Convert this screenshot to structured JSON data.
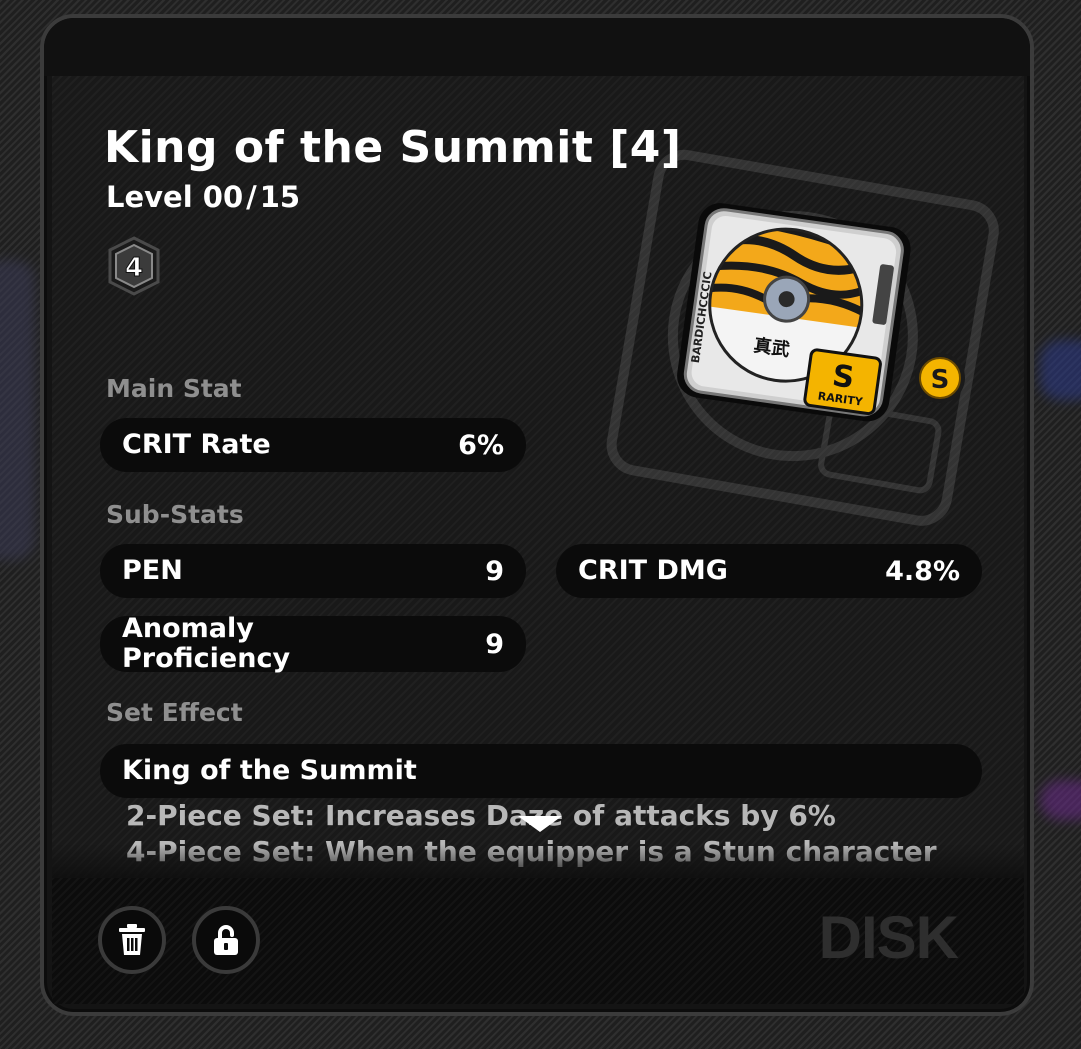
{
  "disk": {
    "name": "King of the Summit",
    "slot_label": "[4]",
    "level_label": "Level",
    "level_current": "00",
    "level_separator": "/",
    "level_max": "15",
    "slot_badge": "4",
    "rank_badge": "S",
    "art_rank_letter": "S",
    "art_rank_text": "RARITY",
    "art_brand_text": "BARDICHCCCIC",
    "art_kanji": "真武"
  },
  "main_stat": {
    "label": "Main Stat",
    "name": "CRIT Rate",
    "value": "6%"
  },
  "sub_stats": {
    "label": "Sub-Stats",
    "items": [
      {
        "name": "PEN",
        "value": "9"
      },
      {
        "name": "CRIT DMG",
        "value": "4.8%"
      },
      {
        "name": "Anomaly Proficiency",
        "value": "9"
      }
    ]
  },
  "set_effect": {
    "label": "Set Effect",
    "name": "King of the Summit",
    "lines": [
      "2-Piece Set: Increases Daze of attacks by 6%",
      "4-Piece Set: When the equipper is a Stun character"
    ]
  },
  "footer": {
    "watermark": "DISK",
    "delete_icon": "trash-icon",
    "lock_icon": "unlock-icon"
  },
  "colors": {
    "accent_gold": "#f4b400",
    "pill_bg": "#0b0b0b",
    "label_gray": "#8f8f8f"
  }
}
